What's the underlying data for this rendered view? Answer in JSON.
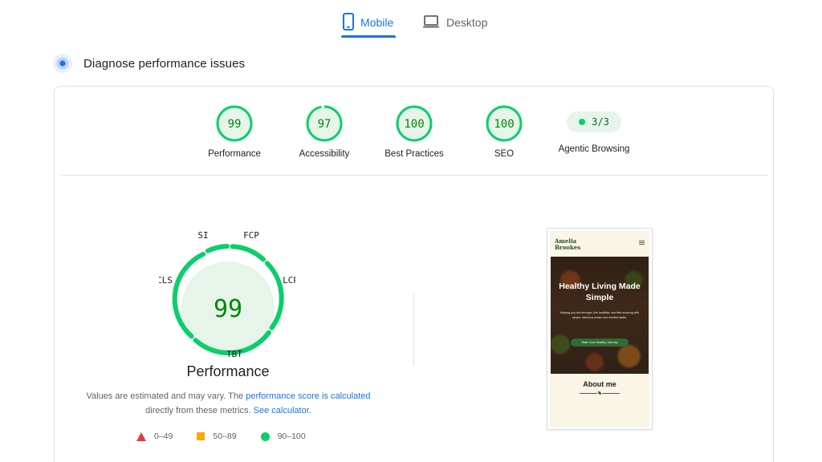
{
  "tabs": [
    {
      "label": "Mobile",
      "icon": "smartphone-icon",
      "selected": true
    },
    {
      "label": "Desktop",
      "icon": "laptop-icon",
      "selected": false
    }
  ],
  "section": {
    "title": "Diagnose performance issues",
    "icon": "diagnose-icon"
  },
  "scores": [
    {
      "key": "performance",
      "value": "99",
      "label": "Performance"
    },
    {
      "key": "accessibility",
      "value": "97",
      "label": "Accessibility"
    },
    {
      "key": "best_practices",
      "value": "100",
      "label": "Best Practices"
    },
    {
      "key": "seo",
      "value": "100",
      "label": "SEO"
    }
  ],
  "agentic": {
    "value": "3/3",
    "label": "Agentic Browsing"
  },
  "big_gauge": {
    "score": "99",
    "label": "Performance",
    "metrics": {
      "si": "SI",
      "fcp": "FCP",
      "lcp": "LCP",
      "tbt": "TBT",
      "cls": "CLS"
    }
  },
  "note": {
    "text_before": "Values are estimated and may vary. The ",
    "link_score": "performance score is calculated",
    "text_middle": " directly from these metrics. ",
    "link_calc": "See calculator."
  },
  "legend": [
    {
      "range": "0–49",
      "shape": "triangle",
      "color": "#e53935"
    },
    {
      "range": "50–89",
      "shape": "square",
      "color": "#ffa400"
    },
    {
      "range": "90–100",
      "shape": "circle",
      "color": "#0cce6b"
    }
  ],
  "screenshot": {
    "brand": "Amelia Brookes",
    "hero_title": "Healthy Living Made Simple",
    "hero_text": "Helping you feel stronger, live healthier, and feel amazing with simple, delicious meals and mindful habits.",
    "hero_button": "Start Your Healthy Journey",
    "about_title": "About me"
  },
  "colors": {
    "accent": "#1a73e8",
    "pass": "#0cce6b",
    "pass_text": "#008800",
    "pass_bg": "#e6f4ea"
  }
}
